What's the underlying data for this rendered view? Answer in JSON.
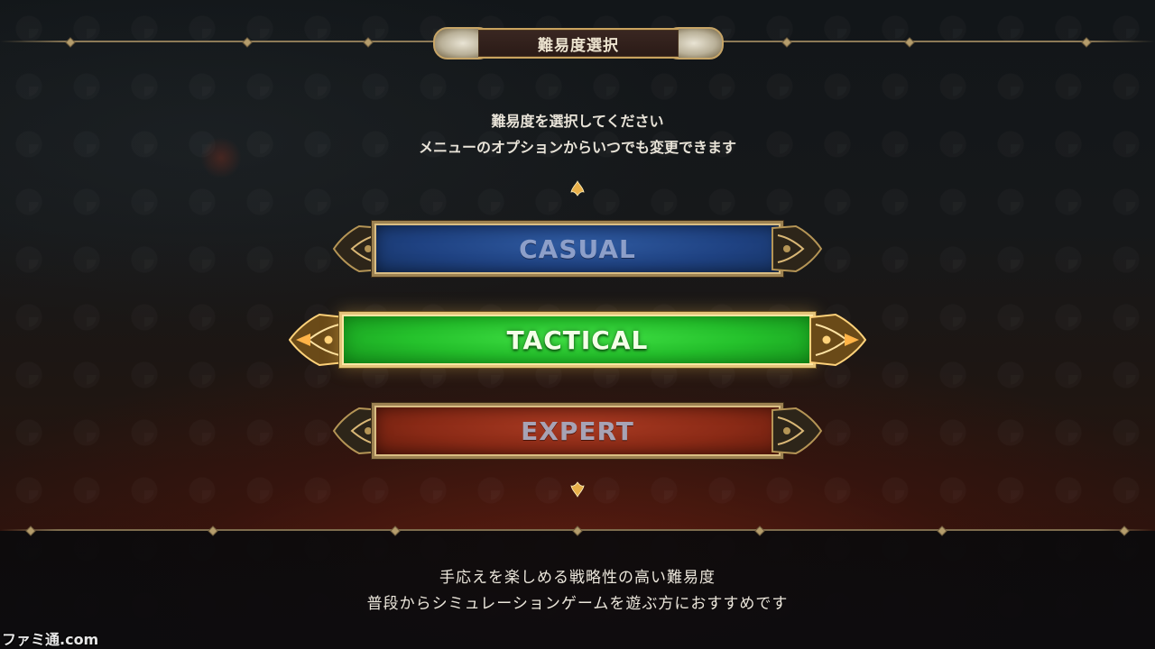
{
  "header": {
    "title": "難易度選択"
  },
  "instructions": {
    "line1": "難易度を選択してください",
    "line2": "メニューのオプションからいつでも変更できます"
  },
  "difficulties": [
    {
      "label": "CASUAL",
      "color": "#1f4282",
      "selected": false
    },
    {
      "label": "TACTICAL",
      "color": "#25c22c",
      "selected": true
    },
    {
      "label": "EXPERT",
      "color": "#8a2a16",
      "selected": false
    }
  ],
  "description": {
    "line1": "手応えを楽しめる戦略性の高い難易度",
    "line2": "普段からシミュレーションゲームを遊ぶ方におすすめです"
  },
  "watermark": {
    "text": "ファミ通.com"
  },
  "icons": {
    "scroll_up": "arrow-up-icon",
    "scroll_down": "arrow-down-icon"
  },
  "colors": {
    "accent_gold": "#c9a35f",
    "text_light": "#e8e3d8"
  }
}
